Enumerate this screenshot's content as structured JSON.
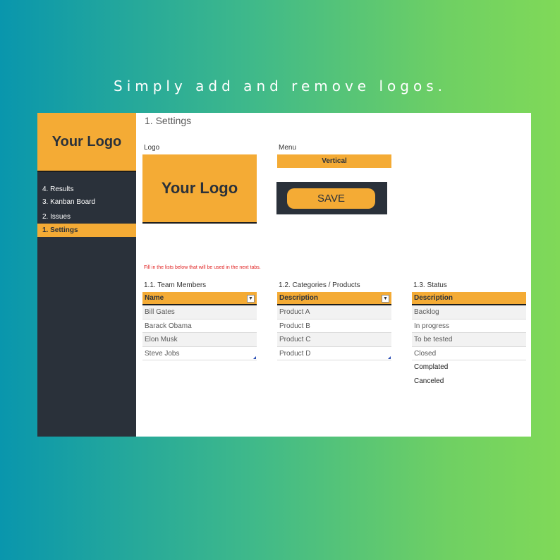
{
  "headline": "Simply add and remove logos.",
  "sidebar": {
    "logo_text": "Your Logo",
    "items": [
      {
        "label": "4. Results",
        "active": false
      },
      {
        "label": "3. Kanban Board",
        "active": false
      },
      {
        "label": "2. Issues",
        "active": false
      },
      {
        "label": "1. Settings",
        "active": true
      }
    ]
  },
  "main": {
    "title": "1. Settings",
    "logo_label": "Logo",
    "logo_text": "Your Logo",
    "menu_label": "Menu",
    "menu_value": "Vertical",
    "save_label": "SAVE",
    "note": "Fill in the lists below that will be used in the next tabs."
  },
  "team": {
    "title": "1.1. Team Members",
    "header": "Name",
    "rows": [
      "Bill Gates",
      "Barack Obama",
      "Elon Musk",
      "Steve Jobs"
    ]
  },
  "categories": {
    "title": "1.2. Categories / Products",
    "header": "Description",
    "rows": [
      "Product A",
      "Product B",
      "Product C",
      "Product D"
    ]
  },
  "status": {
    "title": "1.3. Status",
    "header": "Description",
    "rows": [
      "Backlog",
      "In progress",
      "To be tested",
      "Closed"
    ],
    "extra": [
      "Complated",
      "Canceled"
    ]
  },
  "colors": {
    "accent": "#f4ab35",
    "sidebar": "#2a313a",
    "note": "#e02020"
  }
}
